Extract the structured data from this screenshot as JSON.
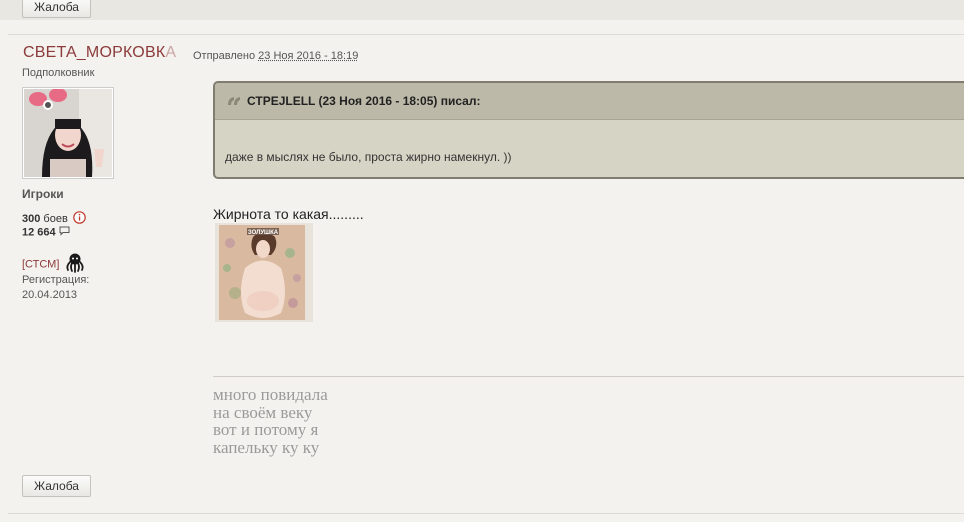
{
  "prev_post": {
    "report_label": "Жалоба"
  },
  "post": {
    "author": {
      "name_main": "СВЕТА_МОРКОВК",
      "name_fade": "А",
      "rank": "Подполковник",
      "group": "Игроки"
    },
    "posted_label": "Отправлено",
    "posted_date": "23 Ноя 2016 - 18:19",
    "stats": {
      "battles_value": "300",
      "battles_label": "боев",
      "posts_value": "12  664"
    },
    "clan_tag": "[СТСМ]",
    "registration_label": "Регистрация:",
    "registration_date": "20.04.2013",
    "quote": {
      "header": "СТРЕJLELL (23 Ноя 2016 - 18:05) писал:",
      "body": "даже в мыслях не было, проста жирно намекнул. ))"
    },
    "text": "Жирнота то какая.........",
    "image_caption": "ЗОЛУШКА",
    "signature": [
      "много повидала",
      "на своём веку",
      "вот и потому я",
      "капельку ку ку"
    ],
    "report_label": "Жалоба"
  },
  "icons": {
    "info": "info-circle-icon",
    "comments": "speech-bubble-icon",
    "clan": "octopus-icon",
    "quote": "quote-icon"
  },
  "colors": {
    "author": "#8c3a3a",
    "quote_bg": "#d6d4c5",
    "quote_head": "#bcb9a8",
    "signature": "#9a9a9a"
  }
}
